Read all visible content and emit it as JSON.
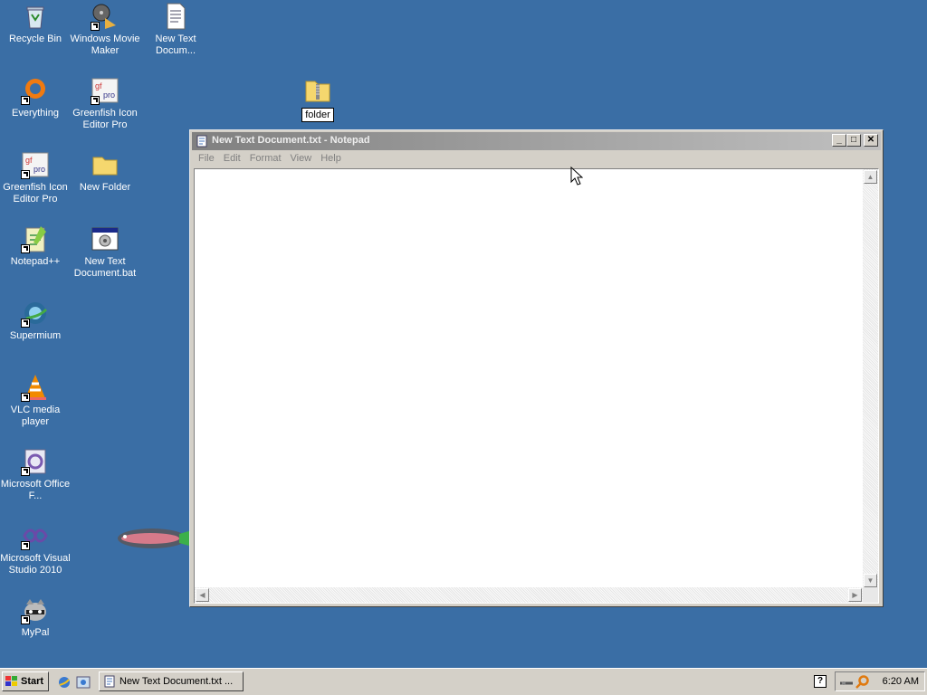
{
  "desktop": {
    "background": "#3a6ea5",
    "icons": [
      {
        "label": "Recycle Bin",
        "icon": "recycle-bin-icon"
      },
      {
        "label": "Windows Movie Maker",
        "icon": "movie-maker-icon"
      },
      {
        "label": "New Text Docum...",
        "icon": "text-document-icon"
      },
      {
        "label": "Everything",
        "icon": "everything-search-icon"
      },
      {
        "label": "Greenfish Icon Editor Pro",
        "icon": "greenfish-icon"
      },
      {
        "label": "folder",
        "icon": "zip-folder-icon"
      },
      {
        "label": "Greenfish Icon Editor Pro",
        "icon": "greenfish-icon"
      },
      {
        "label": "New Folder",
        "icon": "folder-icon"
      },
      {
        "label": "Notepad++",
        "icon": "notepad-plus-plus-icon"
      },
      {
        "label": "New Text Document.bat",
        "icon": "batch-file-icon"
      },
      {
        "label": "Supermium",
        "icon": "supermium-icon"
      },
      {
        "label": "VLC media player",
        "icon": "vlc-icon"
      },
      {
        "label": "Microsoft Office F...",
        "icon": "office-icon"
      },
      {
        "label": "Microsoft Visual Studio 2010",
        "icon": "visual-studio-icon"
      },
      {
        "label": "MyPal",
        "icon": "mypal-icon"
      }
    ]
  },
  "notepad": {
    "title": "New Text Document.txt - Notepad",
    "menu": [
      "File",
      "Edit",
      "Format",
      "View",
      "Help"
    ],
    "content": ""
  },
  "taskbar": {
    "start_label": "Start",
    "task_label": "New Text Document.txt ...",
    "help_label": "?",
    "clock": "6:20 AM"
  }
}
